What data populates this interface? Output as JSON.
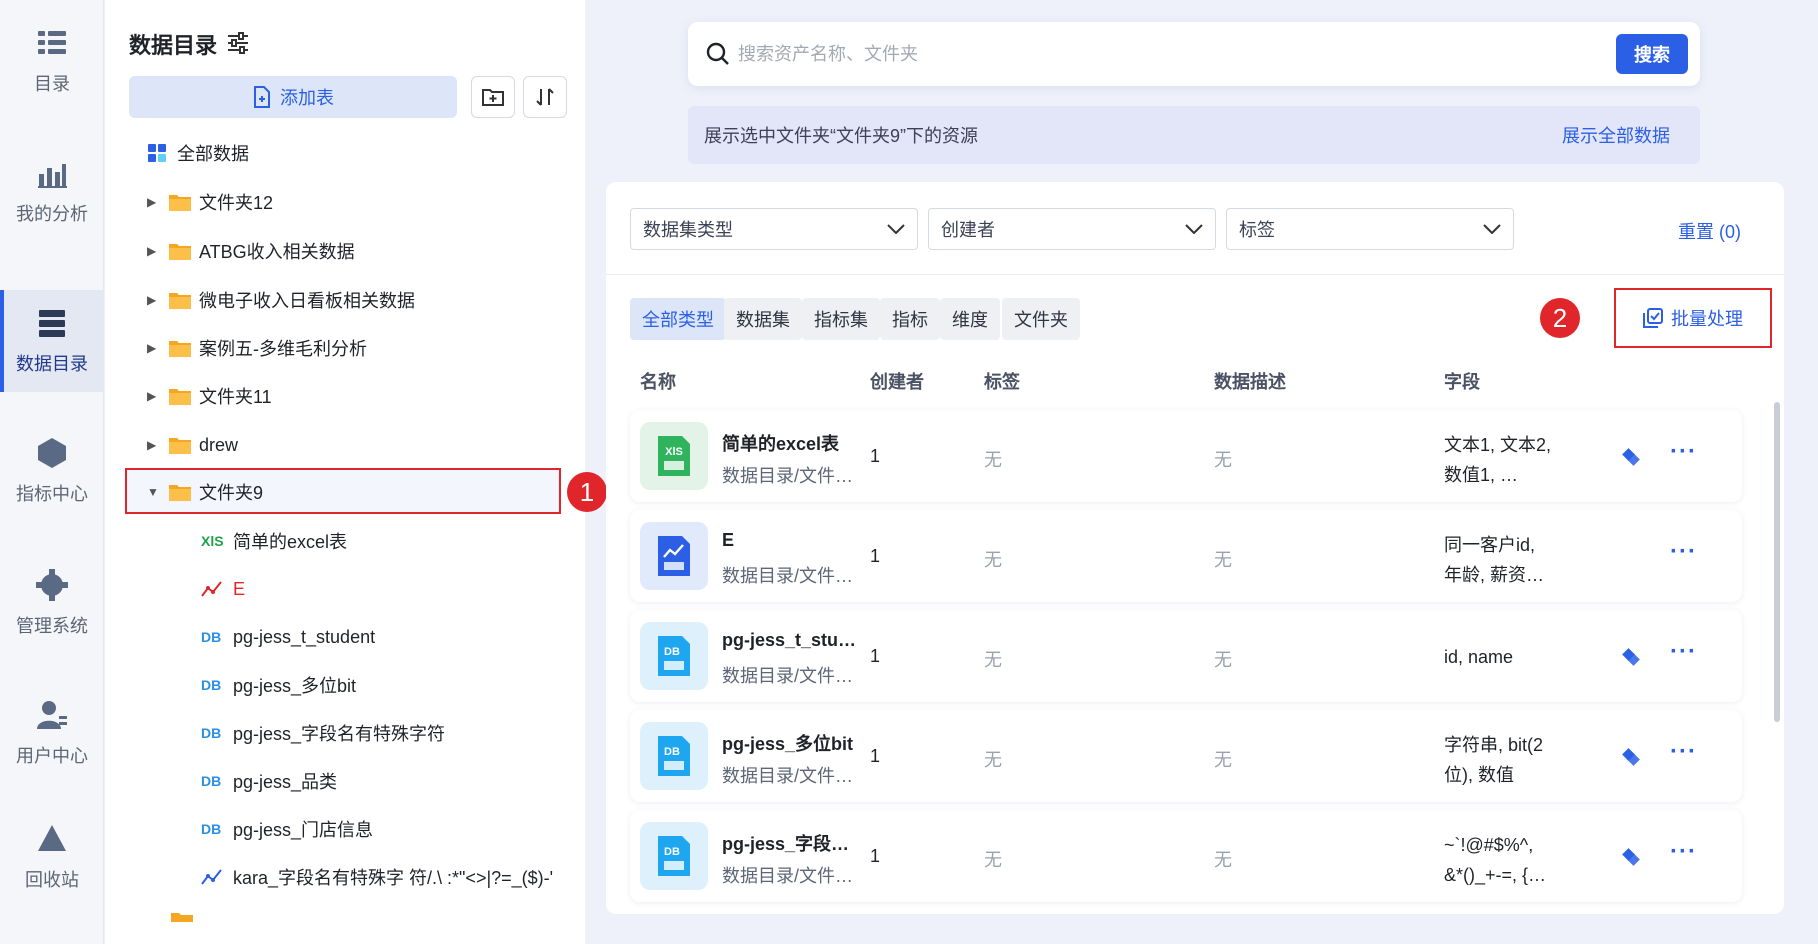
{
  "nav": {
    "items": [
      {
        "label": "目录",
        "icon": "catalog-icon"
      },
      {
        "label": "我的分析",
        "icon": "analysis-icon"
      },
      {
        "label": "数据目录",
        "icon": "data-catalog-icon"
      },
      {
        "label": "指标中心",
        "icon": "metric-center-icon"
      },
      {
        "label": "管理系统",
        "icon": "settings-gear-icon"
      },
      {
        "label": "用户中心",
        "icon": "user-icon"
      },
      {
        "label": "回收站",
        "icon": "recycle-icon"
      }
    ]
  },
  "tree": {
    "title": "数据目录",
    "add_table": "添加表",
    "all_data": "全部数据",
    "folders": [
      {
        "label": "文件夹12"
      },
      {
        "label": "ATBG收入相关数据"
      },
      {
        "label": "微电子收入日看板相关数据"
      },
      {
        "label": "案例五-多维毛利分析"
      },
      {
        "label": "文件夹11"
      },
      {
        "label": "drew"
      },
      {
        "label": "文件夹9"
      }
    ],
    "children": [
      {
        "type_label": "XlS",
        "label": "简单的excel表"
      },
      {
        "type_label": "",
        "label": "E"
      },
      {
        "type_label": "DB",
        "label": "pg-jess_t_student"
      },
      {
        "type_label": "DB",
        "label": "pg-jess_多位bit"
      },
      {
        "type_label": "DB",
        "label": "pg-jess_字段名有特殊字符"
      },
      {
        "type_label": "DB",
        "label": "pg-jess_品类"
      },
      {
        "type_label": "DB",
        "label": "pg-jess_门店信息"
      },
      {
        "type_label": "",
        "label": "kara_字段名有特殊字 符/.\\ :*\"<>|?=_($)-'"
      }
    ],
    "badge1": "1"
  },
  "search": {
    "placeholder": "搜索资产名称、文件夹",
    "button": "搜索"
  },
  "info": {
    "text": "展示选中文件夹“文件夹9”下的资源",
    "link": "展示全部数据"
  },
  "filters": {
    "dataset_type": "数据集类型",
    "creator": "创建者",
    "tag": "标签",
    "reset": "重置 (0)"
  },
  "type_tabs": [
    "全部类型",
    "数据集",
    "指标集",
    "指标",
    "维度",
    "文件夹"
  ],
  "batch": {
    "label": "批量处理",
    "badge2": "2"
  },
  "columns": [
    "名称",
    "创建者",
    "标签",
    "数据描述",
    "字段"
  ],
  "rows": [
    {
      "name": "简单的excel表",
      "path": "数据目录/文件…",
      "creator": "1",
      "tag": "无",
      "desc": "无",
      "field": "文本1, 文本2, 数值1, …",
      "icon": "excel",
      "link": true
    },
    {
      "name": "E",
      "path": "数据目录/文件…",
      "creator": "1",
      "tag": "无",
      "desc": "无",
      "field": "同一客户id, 年龄, 薪资…",
      "icon": "chart",
      "link": false
    },
    {
      "name": "pg-jess_t_stu…",
      "path": "数据目录/文件…",
      "creator": "1",
      "tag": "无",
      "desc": "无",
      "field": "id, name",
      "icon": "db",
      "link": true
    },
    {
      "name": "pg-jess_多位bit",
      "path": "数据目录/文件…",
      "creator": "1",
      "tag": "无",
      "desc": "无",
      "field": "字符串, bit(2位), 数值",
      "icon": "db",
      "link": true
    },
    {
      "name": "pg-jess_字段…",
      "path": "数据目录/文件…",
      "creator": "1",
      "tag": "无",
      "desc": "无",
      "field": "~`!@#$%^, &*()_+-=, {…",
      "icon": "db",
      "link": true
    }
  ],
  "colors": {
    "accent": "#2b5fe6",
    "highlight_red": "#e0262b",
    "folder": "#f5a623"
  }
}
